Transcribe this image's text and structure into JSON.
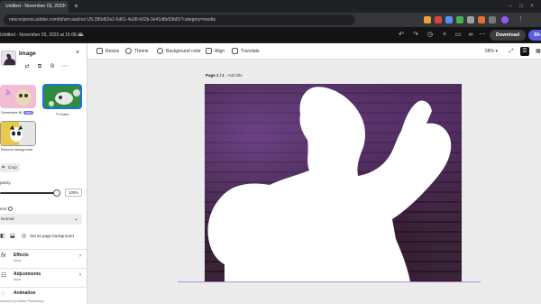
{
  "browser": {
    "tab_title": "Untitled - November 03, 2023",
    "new_tab": "+",
    "url": "new.express.adobe.com/id/urn:aaid:sc:US:280d52e2-6d61-4a38-b02b-3e41d8e53b81?category=media",
    "colors": {
      "tabbar": "#202124",
      "urlbar": "#35363a"
    }
  },
  "app": {
    "doc_title": "Untitled - November 03, 2023 at 15.08.45",
    "download_label": "Download",
    "share_label": "Sh"
  },
  "toolbar": {
    "resize": "Resize",
    "theme": "Theme",
    "background_color": "Background color",
    "align": "Align",
    "translate": "Translate",
    "zoom": "58%"
  },
  "panel": {
    "title": "Image",
    "close": "×",
    "generative_fill_label": "Generative fill",
    "generative_fill_badge": "NEW",
    "erase_label": "Erase",
    "remove_background_label": "Remove background",
    "crop_label": "Crop",
    "opacity_label": "pacity",
    "opacity_value": "100%",
    "opacity_level": 1.0,
    "blend_label": "end",
    "blend_value": "Normal",
    "set_bg_label": "Set as page background",
    "effects_title": "Effects",
    "effects_sub": "None",
    "adjustments_title": "Adjustments",
    "adjustments_sub": "None",
    "animation_title": "Animation",
    "footer": "owered by Adobe Photoshop"
  },
  "canvas": {
    "page_label": "Page 1 / 1",
    "add_title": "- Add title",
    "accent_color": "#b48ad8"
  }
}
